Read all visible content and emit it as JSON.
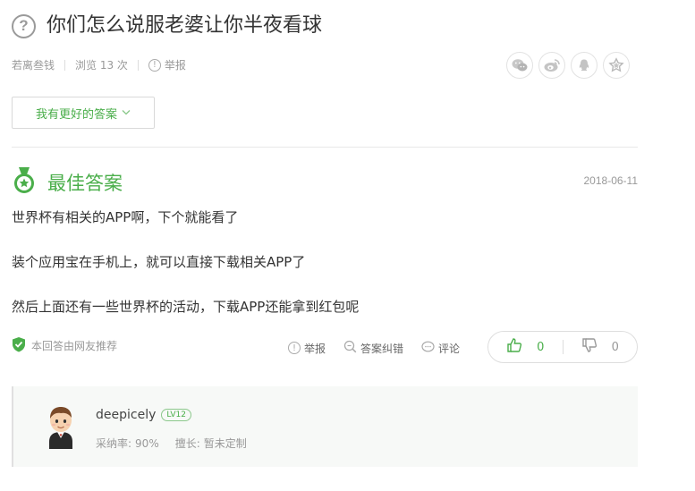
{
  "question": {
    "title": "你们怎么说服老婆让你半夜看球"
  },
  "meta": {
    "author": "若离叁钱",
    "views": "浏览 13 次",
    "report": "举报"
  },
  "share": {
    "icons": [
      "wechat-icon",
      "weibo-icon",
      "qq-icon",
      "favorite-icon"
    ]
  },
  "better_answer_button": "我有更好的答案",
  "best_answer": {
    "title": "最佳答案",
    "date": "2018-06-11",
    "paragraphs": [
      "世界杯有相关的APP啊，下个就能看了",
      "装个应用宝在手机上，就可以直接下载相关APP了",
      "然后上面还有一些世界杯的活动，下载APP还能拿到红包呢"
    ],
    "recommendation": "本回答由网友推荐",
    "actions": {
      "report": "举报",
      "correct": "答案纠错",
      "comment": "评论"
    },
    "votes": {
      "up": "0",
      "down": "0"
    }
  },
  "user": {
    "name": "deepicely",
    "level": "LV12",
    "adopt_label": "采纳率:",
    "adopt_value": "90%",
    "skill_label": "擅长:",
    "skill_value": "暂未定制"
  },
  "colors": {
    "accent": "#4aae4a",
    "muted": "#999999",
    "text": "#333333"
  }
}
